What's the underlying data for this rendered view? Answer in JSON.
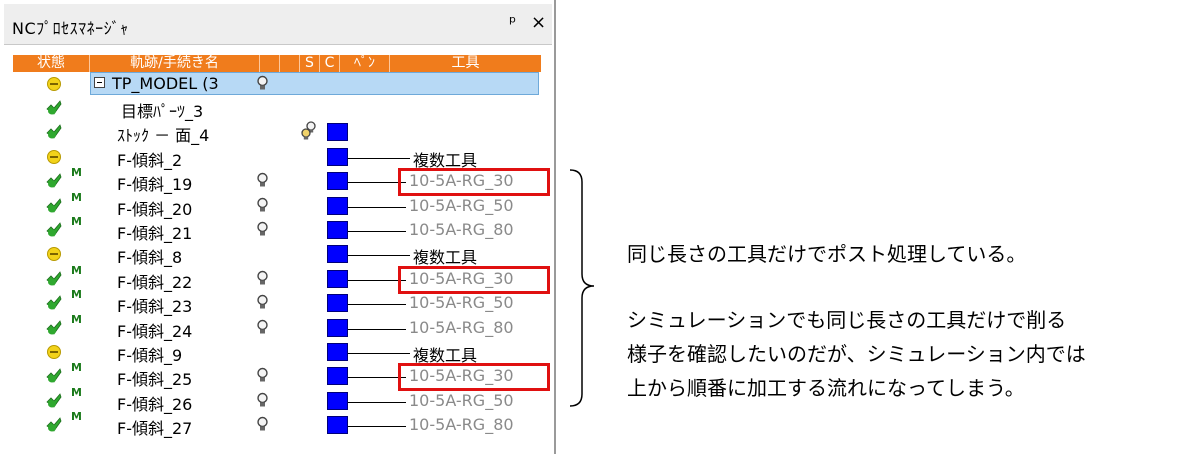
{
  "panel": {
    "title": "NCﾌﾟﾛｾｽﾏﾈｰｼﾞｬ",
    "pin_label": "ᵖ",
    "close_label": "×",
    "columns": [
      "状態",
      "軌跡/手続き名",
      "S",
      "C",
      "ﾍﾟﾝ",
      "工具"
    ]
  },
  "root": {
    "label": "TP_MODEL (3"
  },
  "rows": [
    {
      "status": "green",
      "m": "",
      "name": "目標ﾊﾟｰﾂ_3",
      "bulb": "none",
      "pen": false,
      "tool": ""
    },
    {
      "status": "green",
      "m": "",
      "name": "ｽﾄｯｸ － 面_4",
      "bulb": "double",
      "pen": true,
      "tool": ""
    },
    {
      "status": "yellow",
      "m": "",
      "name": "F-傾斜_2",
      "bulb": "none",
      "pen": true,
      "tool": "複数工具"
    },
    {
      "status": "green",
      "m": "M",
      "name": "F-傾斜_19",
      "bulb": "single",
      "pen": true,
      "tool": "10-5A-RG_30"
    },
    {
      "status": "green",
      "m": "M",
      "name": "F-傾斜_20",
      "bulb": "single",
      "pen": true,
      "tool": "10-5A-RG_50"
    },
    {
      "status": "green",
      "m": "M",
      "name": "F-傾斜_21",
      "bulb": "single",
      "pen": true,
      "tool": "10-5A-RG_80"
    },
    {
      "status": "yellow",
      "m": "",
      "name": "F-傾斜_8",
      "bulb": "none",
      "pen": true,
      "tool": "複数工具"
    },
    {
      "status": "green",
      "m": "M",
      "name": "F-傾斜_22",
      "bulb": "single",
      "pen": true,
      "tool": "10-5A-RG_30"
    },
    {
      "status": "green",
      "m": "M",
      "name": "F-傾斜_23",
      "bulb": "single",
      "pen": true,
      "tool": "10-5A-RG_50"
    },
    {
      "status": "green",
      "m": "M",
      "name": "F-傾斜_24",
      "bulb": "single",
      "pen": true,
      "tool": "10-5A-RG_80"
    },
    {
      "status": "yellow",
      "m": "",
      "name": "F-傾斜_9",
      "bulb": "none",
      "pen": true,
      "tool": "複数工具"
    },
    {
      "status": "green",
      "m": "M",
      "name": "F-傾斜_25",
      "bulb": "single",
      "pen": true,
      "tool": "10-5A-RG_30"
    },
    {
      "status": "green",
      "m": "M",
      "name": "F-傾斜_26",
      "bulb": "single",
      "pen": true,
      "tool": "10-5A-RG_50"
    },
    {
      "status": "green",
      "m": "M",
      "name": "F-傾斜_27",
      "bulb": "single",
      "pen": true,
      "tool": "10-5A-RG_80"
    }
  ],
  "notes": {
    "line1": "同じ長さの工具だけでポスト処理している。",
    "line2": "シミュレーションでも同じ長さの工具だけで削る",
    "line3": "様子を確認したいのだが、シミュレーション内では",
    "line4": "上から順番に加工する流れになってしまう。"
  },
  "colors": {
    "header_bg": "#f07c1c",
    "selection_bg": "#b7d9f5",
    "pen_blue": "#0000ff",
    "highlight_red": "#e01010",
    "status_green": "#2fa82f",
    "status_yellow": "#f2d21a"
  }
}
